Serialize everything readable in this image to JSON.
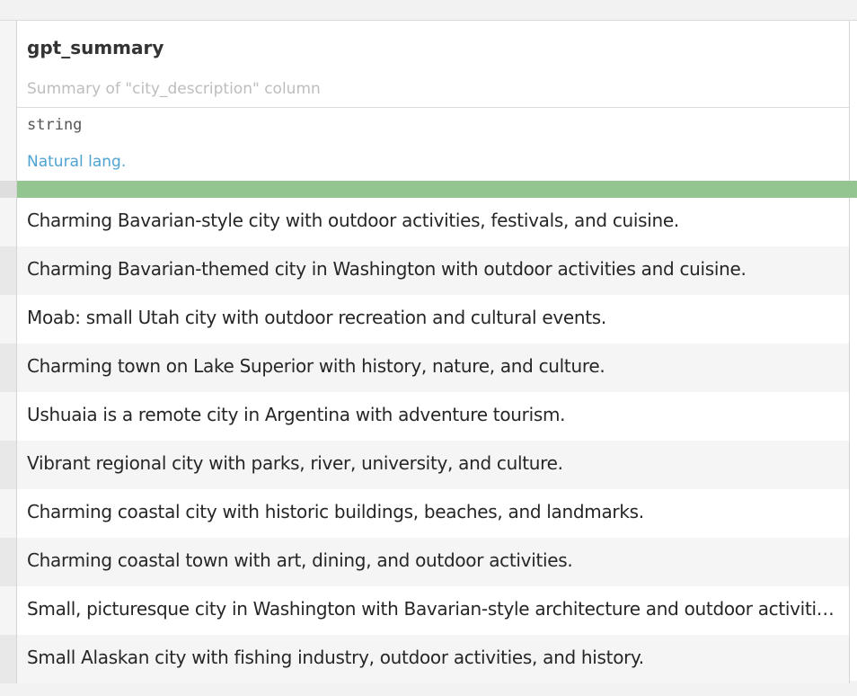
{
  "column": {
    "name": "gpt_summary",
    "description": "Summary of \"city_description\" column",
    "type": "string",
    "meaning": "Natural lang.",
    "quality_color": "#93c591",
    "meaning_color": "#4fa3d1"
  },
  "rows": [
    "Charming Bavarian-style city with outdoor activities, festivals, and cuisine.",
    "Charming Bavarian-themed city in Washington with outdoor activities and cuisine.",
    "Moab: small Utah city with outdoor recreation and cultural events.",
    "Charming town on Lake Superior with history, nature, and culture.",
    "Ushuaia is a remote city in Argentina with adventure tourism.",
    "Vibrant regional city with parks, river, university, and culture.",
    "Charming coastal city with historic buildings, beaches, and landmarks.",
    "Charming coastal town with art, dining, and outdoor activities.",
    "Small, picturesque city in Washington with Bavarian-style architecture and outdoor activities.",
    "Small Alaskan city with fishing industry, outdoor activities, and history."
  ]
}
